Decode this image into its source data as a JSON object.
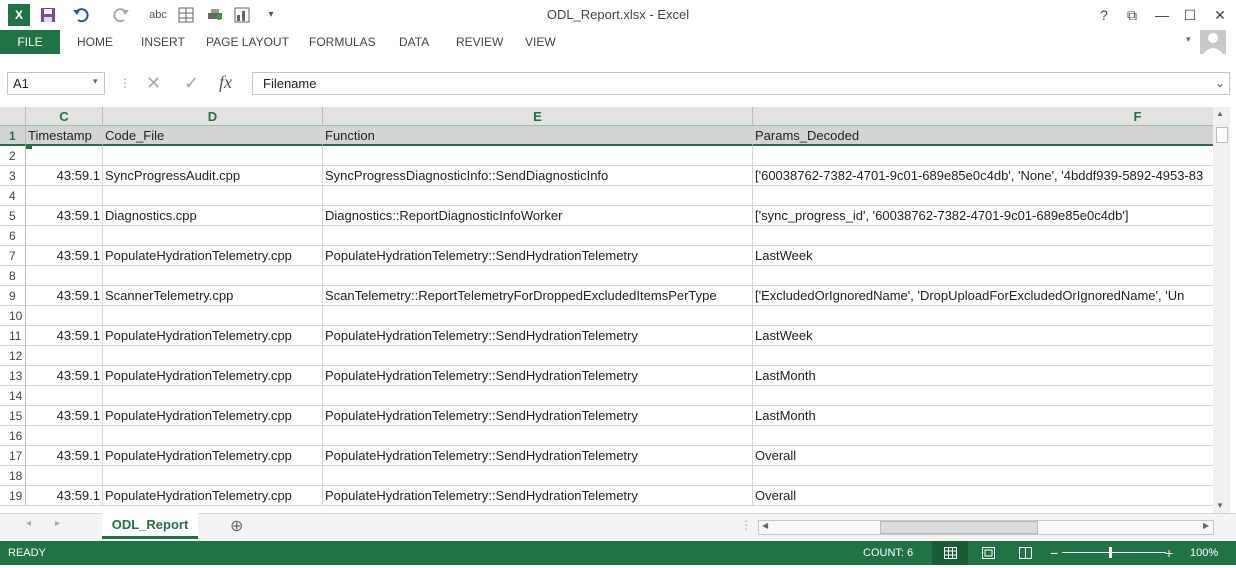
{
  "window": {
    "title": "ODL_Report.xlsx - Excel",
    "help_label": "?",
    "restore_label": "⧉",
    "minimize_label": "—",
    "maximize_label": "☐",
    "close_label": "✕"
  },
  "quick_access": {
    "logo_label": "X",
    "save_icon": "save-icon",
    "undo_icon": "undo-icon",
    "redo_icon": "redo-icon",
    "spelling_label": "abc"
  },
  "ribbon": {
    "file_label": "FILE",
    "tabs": [
      "HOME",
      "INSERT",
      "PAGE LAYOUT",
      "FORMULAS",
      "DATA",
      "REVIEW",
      "VIEW"
    ]
  },
  "formula_bar": {
    "name_box": "A1",
    "fx_label": "fx",
    "value": "Filename"
  },
  "grid": {
    "columns": [
      "C",
      "D",
      "E",
      "F"
    ],
    "header_row": {
      "num": "1",
      "c": "Timestamp",
      "d": "Code_File",
      "e": "Function",
      "f": "Params_Decoded"
    },
    "rows": [
      {
        "num": "2",
        "c": "",
        "d": "",
        "e": "",
        "f": ""
      },
      {
        "num": "3",
        "c": "43:59.1",
        "d": "SyncProgressAudit.cpp",
        "e": "SyncProgressDiagnosticInfo::SendDiagnosticInfo",
        "f": "['60038762-7382-4701-9c01-689e85e0c4db', 'None', '4bddf939-5892-4953-83"
      },
      {
        "num": "4",
        "c": "",
        "d": "",
        "e": "",
        "f": ""
      },
      {
        "num": "5",
        "c": "43:59.1",
        "d": "Diagnostics.cpp",
        "e": "Diagnostics::ReportDiagnosticInfoWorker",
        "f": "['sync_progress_id', '60038762-7382-4701-9c01-689e85e0c4db']"
      },
      {
        "num": "6",
        "c": "",
        "d": "",
        "e": "",
        "f": ""
      },
      {
        "num": "7",
        "c": "43:59.1",
        "d": "PopulateHydrationTelemetry.cpp",
        "e": "PopulateHydrationTelemetry::SendHydrationTelemetry",
        "f": "LastWeek"
      },
      {
        "num": "8",
        "c": "",
        "d": "",
        "e": "",
        "f": ""
      },
      {
        "num": "9",
        "c": "43:59.1",
        "d": "ScannerTelemetry.cpp",
        "e": "ScanTelemetry::ReportTelemetryForDroppedExcludedItemsPerType",
        "f": "['ExcludedOrIgnoredName', 'DropUploadForExcludedOrIgnoredName', 'Un"
      },
      {
        "num": "10",
        "c": "",
        "d": "",
        "e": "",
        "f": ""
      },
      {
        "num": "11",
        "c": "43:59.1",
        "d": "PopulateHydrationTelemetry.cpp",
        "e": "PopulateHydrationTelemetry::SendHydrationTelemetry",
        "f": "LastWeek"
      },
      {
        "num": "12",
        "c": "",
        "d": "",
        "e": "",
        "f": ""
      },
      {
        "num": "13",
        "c": "43:59.1",
        "d": "PopulateHydrationTelemetry.cpp",
        "e": "PopulateHydrationTelemetry::SendHydrationTelemetry",
        "f": "LastMonth"
      },
      {
        "num": "14",
        "c": "",
        "d": "",
        "e": "",
        "f": ""
      },
      {
        "num": "15",
        "c": "43:59.1",
        "d": "PopulateHydrationTelemetry.cpp",
        "e": "PopulateHydrationTelemetry::SendHydrationTelemetry",
        "f": "LastMonth"
      },
      {
        "num": "16",
        "c": "",
        "d": "",
        "e": "",
        "f": ""
      },
      {
        "num": "17",
        "c": "43:59.1",
        "d": "PopulateHydrationTelemetry.cpp",
        "e": "PopulateHydrationTelemetry::SendHydrationTelemetry",
        "f": "Overall"
      },
      {
        "num": "18",
        "c": "",
        "d": "",
        "e": "",
        "f": ""
      },
      {
        "num": "19",
        "c": "43:59.1",
        "d": "PopulateHydrationTelemetry.cpp",
        "e": "PopulateHydrationTelemetry::SendHydrationTelemetry",
        "f": "Overall"
      }
    ]
  },
  "sheets": {
    "active": "ODL_Report",
    "add_label": "⊕"
  },
  "status": {
    "ready": "READY",
    "count": "COUNT: 6",
    "zoom_out": "−",
    "zoom_in": "+",
    "zoom": "100%"
  },
  "colors": {
    "accent": "#217346"
  }
}
